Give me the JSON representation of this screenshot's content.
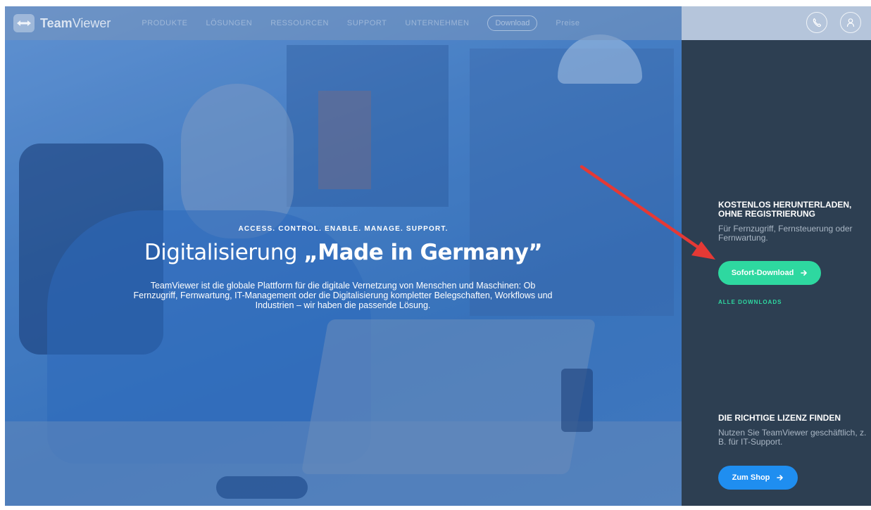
{
  "nav": {
    "logo_bold": "Team",
    "logo_regular": "Viewer",
    "items": [
      "PRODUKTE",
      "LÖSUNGEN",
      "RESSOURCEN",
      "SUPPORT",
      "UNTERNEHMEN"
    ],
    "download_label": "Download",
    "trial_label": "Preise"
  },
  "hero": {
    "eyebrow": "ACCESS. CONTROL. ENABLE. MANAGE. SUPPORT.",
    "title_regular": "Digitalisierung",
    "title_bold": "„Made in Germany”",
    "description": "TeamViewer ist die globale Plattform für die digitale Vernetzung von Menschen und Maschinen: Ob Fernzugriff, Fernwartung, IT-Management oder die Digitalisierung kompletter Belegschaften, Workflows und Industrien – wir haben die passende Lösung."
  },
  "panel": {
    "download_heading": "KOSTENLOS HERUNTERLADEN, OHNE REGISTRIERUNG",
    "download_text": "Für Fernzugriff, Fernsteuerung oder Fernwartung.",
    "download_button": "Sofort-Download",
    "all_downloads": "ALLE DOWNLOADS",
    "license_heading": "DIE RICHTIGE LIZENZ FINDEN",
    "license_text": "Nutzen Sie TeamViewer geschäftlich, z. B. für IT-Support.",
    "shop_button": "Zum Shop"
  },
  "colors": {
    "accent_green": "#2ed8a0",
    "accent_blue": "#1f8ef0",
    "panel_bg": "#2d3f52",
    "annotation_arrow": "#e53935"
  }
}
